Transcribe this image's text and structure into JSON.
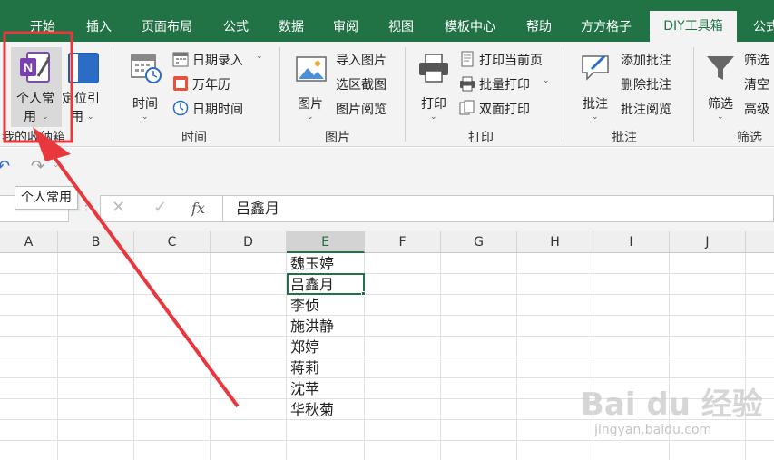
{
  "tabs": [
    {
      "label": "开始"
    },
    {
      "label": "插入"
    },
    {
      "label": "页面布局"
    },
    {
      "label": "公式"
    },
    {
      "label": "数据"
    },
    {
      "label": "审阅"
    },
    {
      "label": "视图"
    },
    {
      "label": "模板中心"
    },
    {
      "label": "帮助"
    },
    {
      "label": "方方格子"
    },
    {
      "label": "DIY工具箱",
      "active": true
    },
    {
      "label": "公式"
    }
  ],
  "ribbon": {
    "favorites": {
      "personal_line1": "个人常",
      "personal_line2": "用",
      "locate_line1": "定位引",
      "locate_line2": "用",
      "group_label": "我的收纳箱"
    },
    "time": {
      "time_label": "时间",
      "date_entry": "日期录入",
      "calendar": "万年历",
      "date_time": "日期时间",
      "group_label": "时间"
    },
    "picture": {
      "picture_label": "图片",
      "import_picture": "导入图片",
      "area_capture": "选区截图",
      "picture_view": "图片阅览",
      "group_label": "图片"
    },
    "print": {
      "print_label": "打印",
      "print_current": "打印当前页",
      "batch_print": "批量打印",
      "duplex_print": "双面打印",
      "group_label": "打印"
    },
    "comment": {
      "comment_label": "批注",
      "add_comment": "添加批注",
      "delete_comment": "删除批注",
      "view_comment": "批注阅览",
      "group_label": "批注"
    },
    "filter": {
      "filter_label": "筛选",
      "filter_1": "筛选",
      "filter_2": "清空",
      "filter_3": "高级",
      "group_label": "筛选"
    }
  },
  "tooltip": "个人常用",
  "formula_bar": {
    "fx": "fx",
    "value": "吕鑫月"
  },
  "columns": [
    "A",
    "B",
    "C",
    "D",
    "E",
    "F",
    "G",
    "H",
    "I",
    "J"
  ],
  "selected_column": "E",
  "cells_e": [
    "魏玉婷",
    "吕鑫月",
    "李侦",
    "施洪静",
    "郑婷",
    "蒋莉",
    "沈苹",
    "华秋菊"
  ],
  "watermark": {
    "brand": "Bai du 经验",
    "url": "jingyan.baidu.com"
  },
  "colors": {
    "excel_green": "#217346",
    "highlight_red": "#e8383d"
  }
}
